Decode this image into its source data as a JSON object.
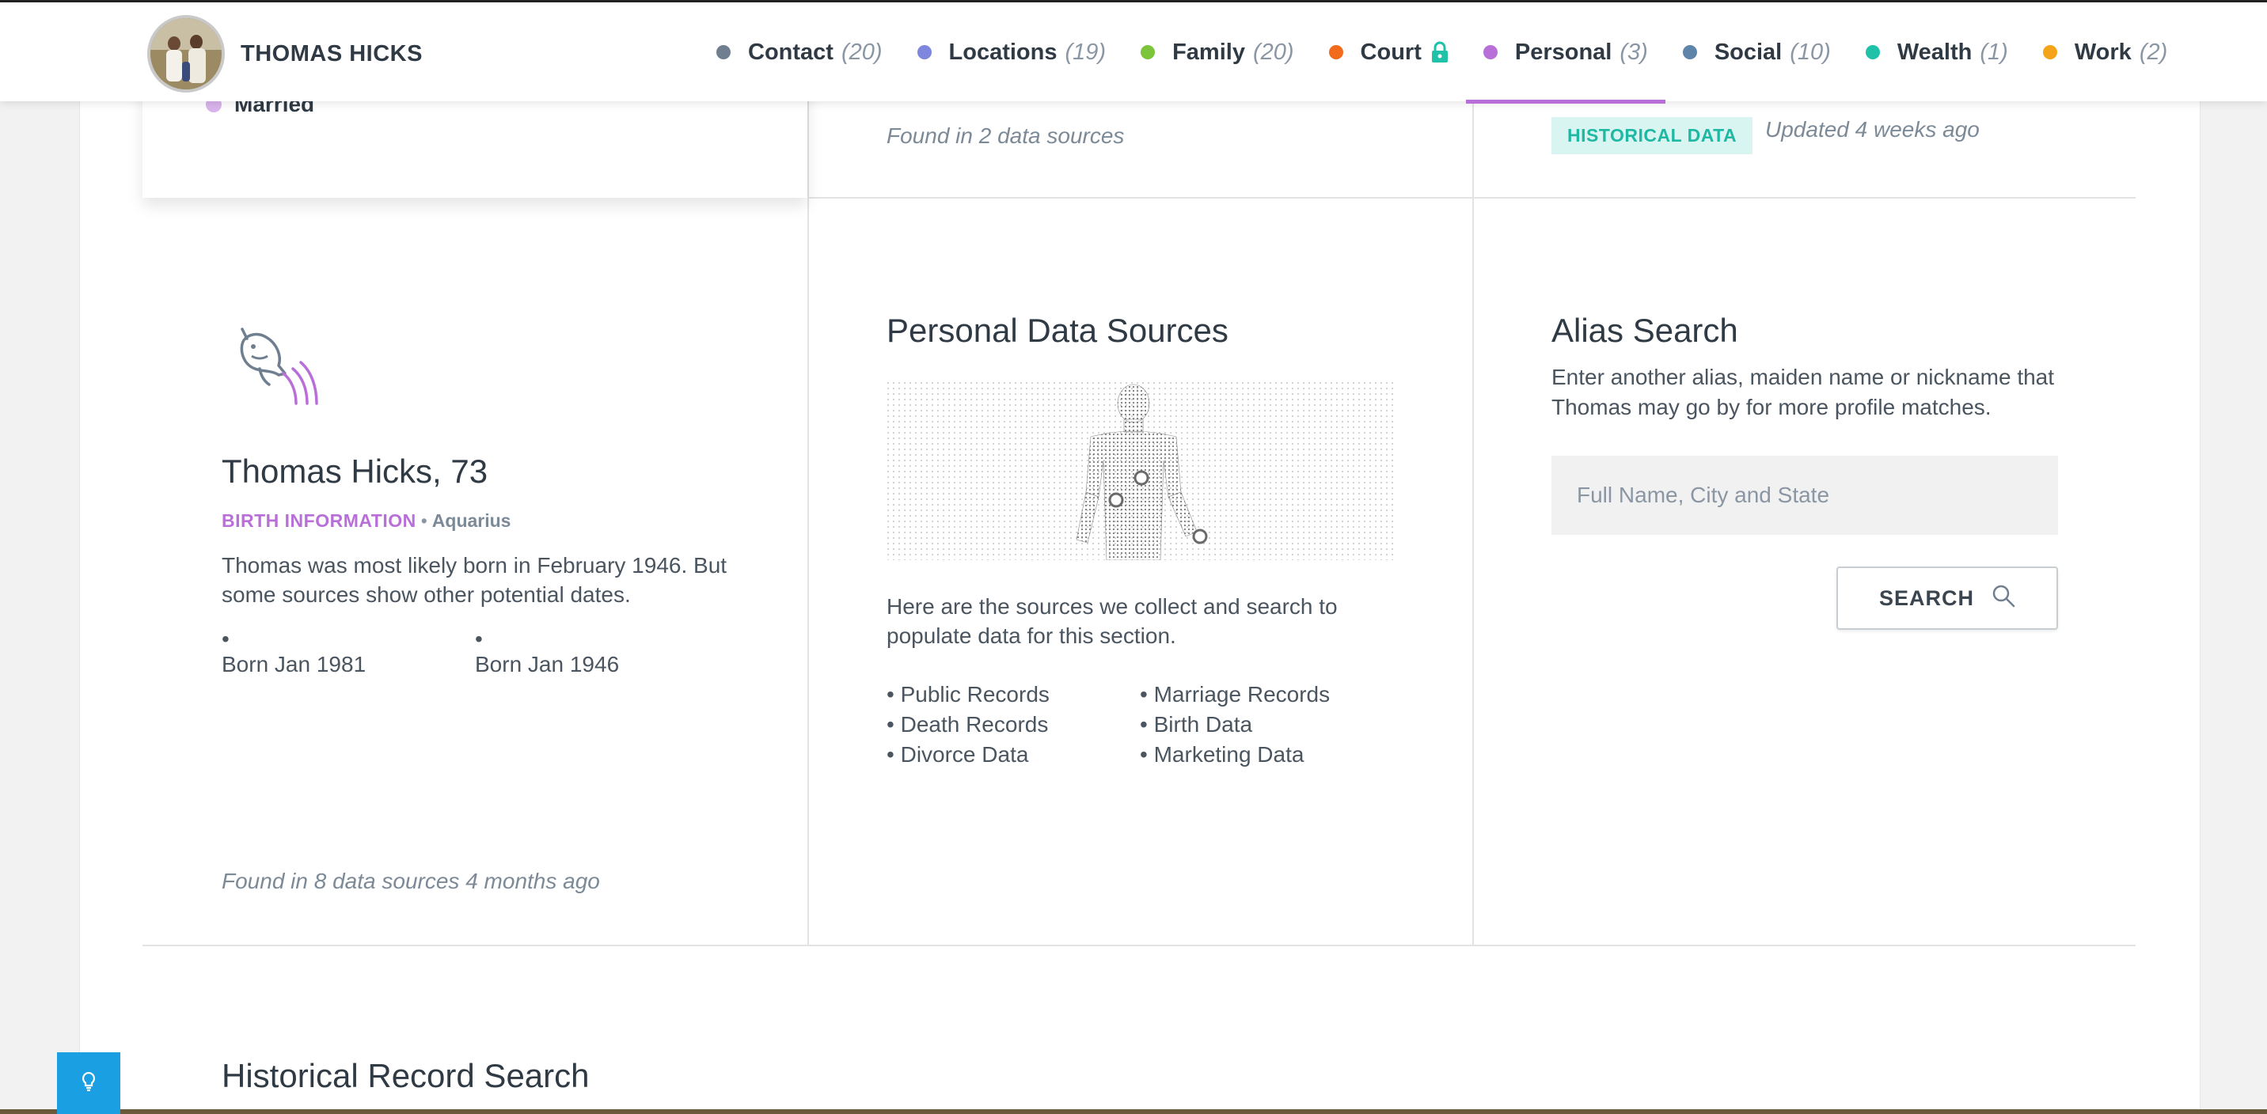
{
  "header": {
    "profile_name": "THOMAS HICKS",
    "nav": [
      {
        "label": "Contact",
        "count": "(20)",
        "color": "#6f7f8f"
      },
      {
        "label": "Locations",
        "count": "(19)",
        "color": "#7f86dd"
      },
      {
        "label": "Family",
        "count": "(20)",
        "color": "#7cc53a"
      },
      {
        "label": "Court",
        "count": "",
        "color": "#f26a1b",
        "locked": true
      },
      {
        "label": "Personal",
        "count": "(3)",
        "color": "#b86fd8",
        "active": true
      },
      {
        "label": "Social",
        "count": "(10)",
        "color": "#5f84aa"
      },
      {
        "label": "Wealth",
        "count": "(1)",
        "color": "#1fc1a9"
      },
      {
        "label": "Work",
        "count": "(2)",
        "color": "#f5a319"
      }
    ]
  },
  "top_card": {
    "relationship_status": "Married"
  },
  "top_row": {
    "found_text": "Found in 2 data sources",
    "badge": "HISTORICAL DATA",
    "updated_text": "Updated 4 weeks ago"
  },
  "birth": {
    "icon": "aquarius-fish-icon",
    "title": "Thomas Hicks, 73",
    "label": "BIRTH INFORMATION",
    "separator": "•",
    "sign": "Aquarius",
    "description": "Thomas was most likely born in February 1946. But some sources show other potential dates.",
    "dates": [
      "Born Jan 1981",
      "Born Jan 1946"
    ],
    "found_text": "Found in 8 data sources 4 months ago"
  },
  "personal_sources": {
    "title": "Personal Data Sources",
    "description": "Here are the sources we collect and search to populate data for this section.",
    "sources": [
      "Public Records",
      "Marriage Records",
      "Death Records",
      "Birth Data",
      "Divorce Data",
      "Marketing Data"
    ]
  },
  "alias_search": {
    "title": "Alias Search",
    "description": "Enter another alias, maiden name or nickname that Thomas may go by for more profile matches.",
    "placeholder": "Full Name, City and State",
    "button_label": "SEARCH"
  },
  "historical": {
    "title": "Historical Record Search"
  },
  "colors": {
    "accent_purple": "#b86fd8",
    "teal": "#1fb8a3",
    "help_blue": "#1a9fe3"
  }
}
